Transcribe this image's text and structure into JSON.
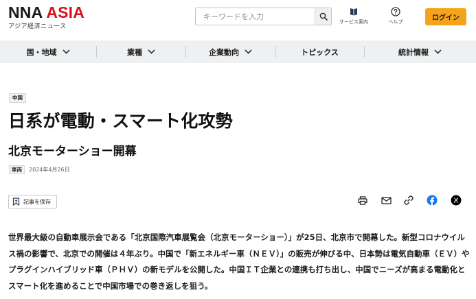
{
  "header": {
    "logo_nna": "NNA",
    "logo_asia": "ASIA",
    "logo_sub": "アジア経済ニュース",
    "search_placeholder": "キーワードを入力",
    "service_label": "サービス案内",
    "help_label": "ヘルプ",
    "login_label": "ログイン",
    "login_color": "#f5a31a",
    "brand_red": "#d7111b"
  },
  "nav": {
    "items": [
      {
        "label": "国・地域",
        "has_dropdown": true
      },
      {
        "label": "業種",
        "has_dropdown": true
      },
      {
        "label": "企業動向",
        "has_dropdown": true
      },
      {
        "label": "トピックス",
        "has_dropdown": false
      },
      {
        "label": "統計情報",
        "has_dropdown": true
      }
    ]
  },
  "article": {
    "region_tag": "中国",
    "title": "日系が電動・スマート化攻勢",
    "subtitle": "北京モーターショー開幕",
    "category": "車両",
    "date": "2024年4月26日",
    "save_label": "記事を保存",
    "share_icons": [
      "print-icon",
      "mail-icon",
      "link-icon",
      "facebook-icon",
      "x-icon"
    ],
    "body": "世界最大級の自動車展示会である「北京国際汽車展覧会（北京モーターショー）」が25日、北京市で開幕した。新型コロナウイルス禍の影響で、北京での開催は４年ぶり。中国で「新エネルギー車（ＮＥＶ）」の販売が伸びる中、日本勢は電気自動車（ＥＶ）やプラグインハイブリッド車（ＰＨＶ）の新モデルを公開した。中国ＩＴ企業との連携も打ち出し、中国でニーズが高まる電動化とスマート化を進めることで中国市場での巻き返しを狙う。"
  }
}
